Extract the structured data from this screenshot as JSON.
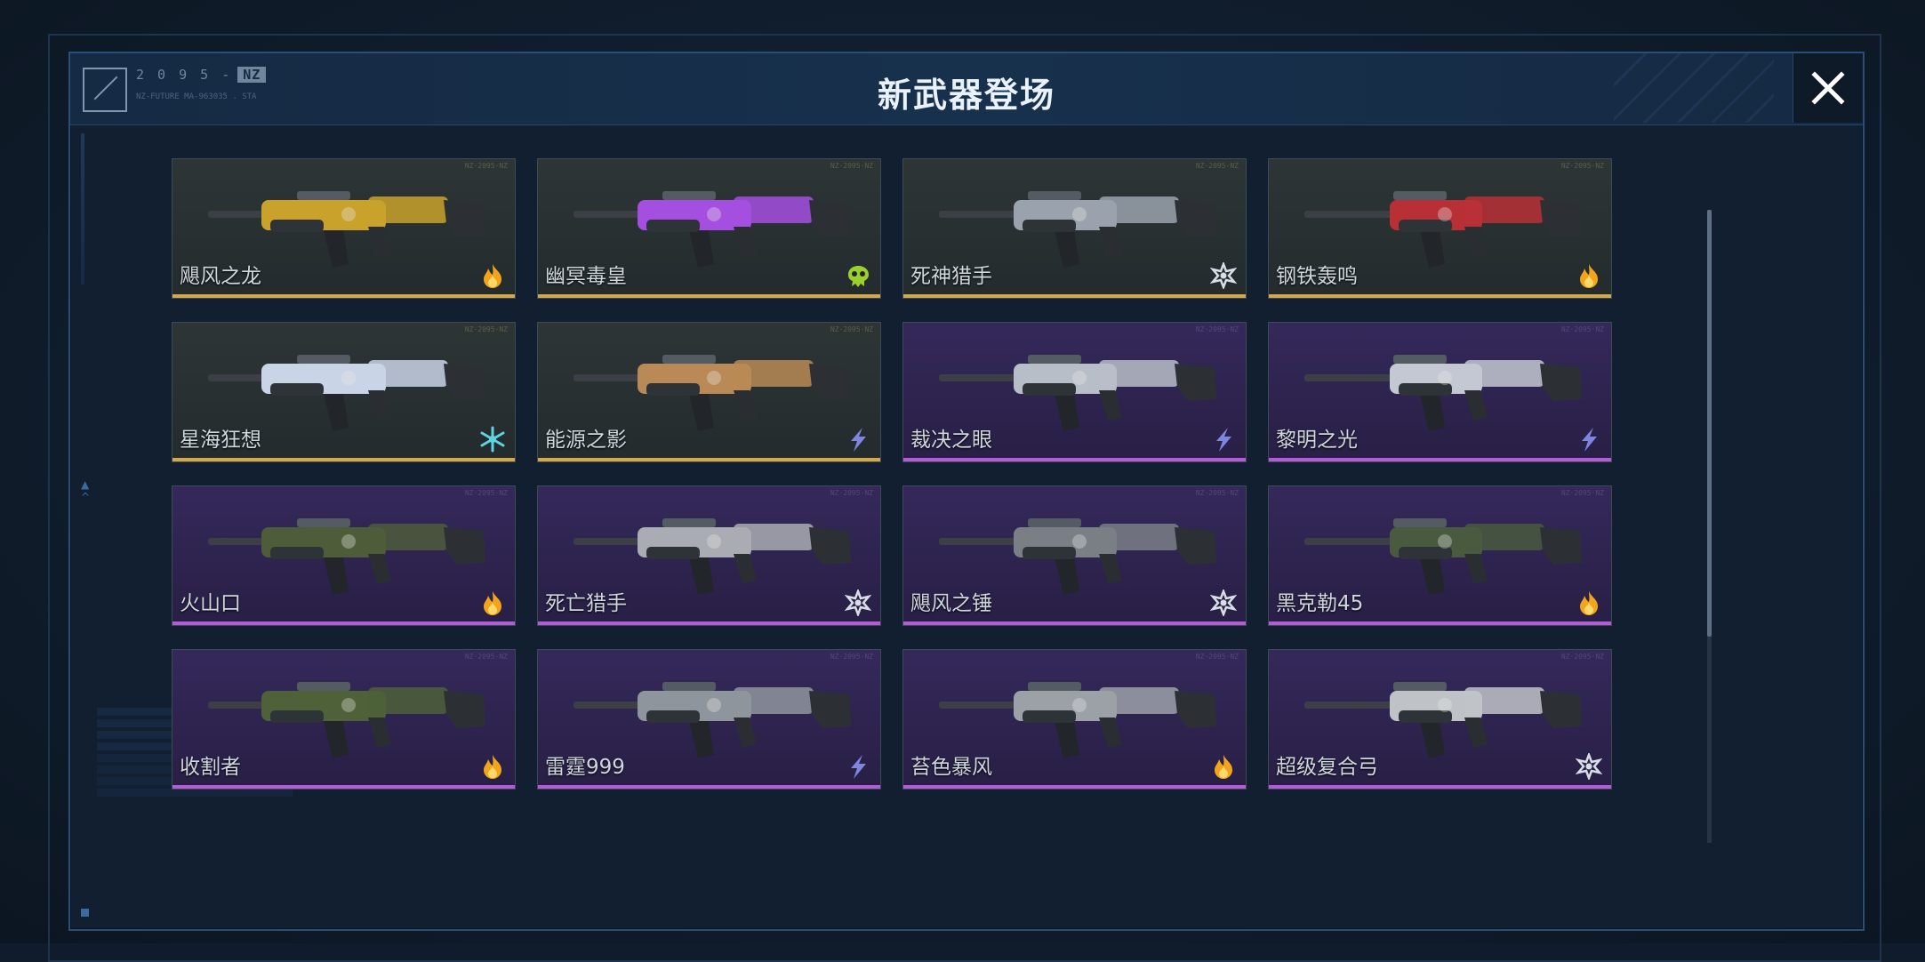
{
  "header": {
    "title": "新武器登场",
    "logo_code": "2 0 9 5 -",
    "logo_tag": "NZ",
    "logo_sub": "NZ-FUTURE MA-963035 . STA"
  },
  "colors": {
    "gold_rarity": "#d6a948",
    "purple_rarity": "#b65bd8",
    "fire_icon": "#f2a51c",
    "lightning_icon": "#7e86e0",
    "poison_icon": "#9bd12c",
    "ice_icon": "#5fd4e0",
    "frost_icon": "#d8dee6"
  },
  "weapons": [
    {
      "name": "飓风之龙",
      "rarity": "gold",
      "element": "fire-icon",
      "weapon_color": "#c8a22a"
    },
    {
      "name": "幽冥毒皇",
      "rarity": "gold",
      "element": "poison-icon",
      "weapon_color": "#a54fe0"
    },
    {
      "name": "死神猎手",
      "rarity": "gold",
      "element": "frost-icon",
      "weapon_color": "#9aa3ad"
    },
    {
      "name": "钢铁轰鸣",
      "rarity": "gold",
      "element": "fire-icon",
      "weapon_color": "#b83036"
    },
    {
      "name": "星海狂想",
      "rarity": "gold",
      "element": "ice-icon",
      "weapon_color": "#c9d4e6"
    },
    {
      "name": "能源之影",
      "rarity": "gold",
      "element": "lightning-icon",
      "weapon_color": "#b98a55"
    },
    {
      "name": "裁决之眼",
      "rarity": "purple",
      "element": "lightning-icon",
      "weapon_color": "#b8bec8"
    },
    {
      "name": "黎明之光",
      "rarity": "purple",
      "element": "lightning-icon",
      "weapon_color": "#c3c8d2"
    },
    {
      "name": "火山口",
      "rarity": "purple",
      "element": "fire-icon",
      "weapon_color": "#4f5c3a"
    },
    {
      "name": "死亡猎手",
      "rarity": "purple",
      "element": "frost-icon",
      "weapon_color": "#a9adb3"
    },
    {
      "name": "飓风之锤",
      "rarity": "purple",
      "element": "frost-icon",
      "weapon_color": "#7a7f86"
    },
    {
      "name": "黑克勒45",
      "rarity": "purple",
      "element": "fire-icon",
      "weapon_color": "#4a5a3e"
    },
    {
      "name": "收割者",
      "rarity": "purple",
      "element": "fire-icon",
      "weapon_color": "#4e6138"
    },
    {
      "name": "雷霆999",
      "rarity": "purple",
      "element": "lightning-icon",
      "weapon_color": "#8f959c"
    },
    {
      "name": "苔色暴风",
      "rarity": "purple",
      "element": "fire-icon",
      "weapon_color": "#9ca1a8"
    },
    {
      "name": "超级复合弓",
      "rarity": "purple",
      "element": "frost-icon",
      "weapon_color": "#bfc3c8"
    }
  ]
}
